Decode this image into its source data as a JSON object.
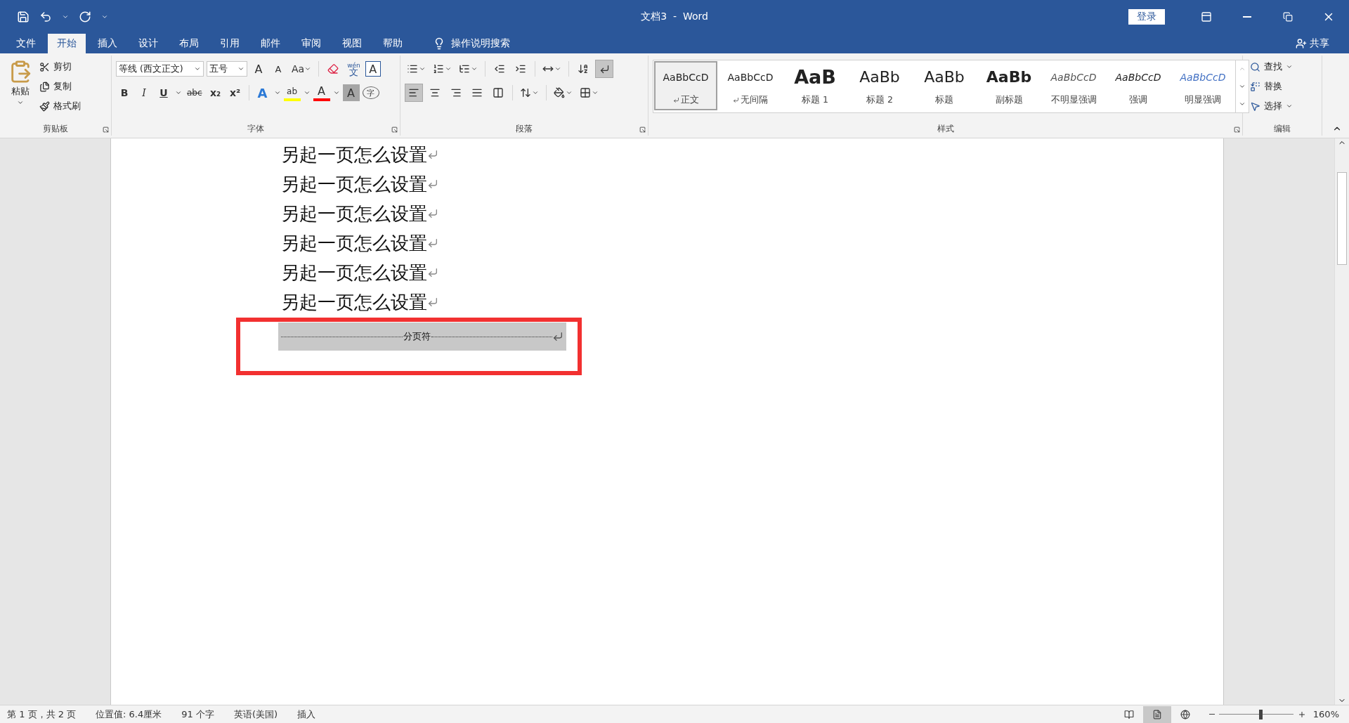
{
  "window": {
    "title": "文档3  -  Word",
    "login": "登录"
  },
  "tabs": [
    {
      "label": "文件",
      "selected": false
    },
    {
      "label": "开始",
      "selected": true
    },
    {
      "label": "插入",
      "selected": false
    },
    {
      "label": "设计",
      "selected": false
    },
    {
      "label": "布局",
      "selected": false
    },
    {
      "label": "引用",
      "selected": false
    },
    {
      "label": "邮件",
      "selected": false
    },
    {
      "label": "审阅",
      "selected": false
    },
    {
      "label": "视图",
      "selected": false
    },
    {
      "label": "帮助",
      "selected": false
    }
  ],
  "tell_me": "操作说明搜索",
  "share": "共享",
  "clipboard": {
    "paste": "粘贴",
    "items": [
      "剪切",
      "复制",
      "格式刷"
    ],
    "label": "剪贴板"
  },
  "font": {
    "name": "等线 (西文正文)",
    "size": "五号",
    "label": "字体",
    "tools": [
      {
        "kind": "grow",
        "label": "A"
      },
      {
        "kind": "shrink",
        "label": "A"
      },
      {
        "kind": "case",
        "label": "Aa"
      }
    ],
    "phonetic": {
      "top": "wén",
      "bottom": "文"
    },
    "border_char": "A",
    "format_buttons": [
      {
        "kind": "bold",
        "label": "B"
      },
      {
        "kind": "italic",
        "label": "I"
      },
      {
        "kind": "underline",
        "label": "U"
      },
      {
        "kind": "strike",
        "label": "abc"
      },
      {
        "kind": "subscript",
        "label": "x₂"
      },
      {
        "kind": "superscript",
        "label": "x²"
      },
      {
        "kind": "text_effect",
        "label": "A"
      },
      {
        "kind": "highlight",
        "label": "ab"
      },
      {
        "kind": "font_color",
        "label": "A"
      },
      {
        "kind": "shading",
        "label": "A"
      },
      {
        "kind": "enclose",
        "label": "字"
      }
    ]
  },
  "paragraph": {
    "label": "段落",
    "show_marks": {
      "selected": true
    },
    "alignments": [
      {
        "kind": "left",
        "selected": true
      },
      {
        "kind": "center",
        "selected": false
      },
      {
        "kind": "right",
        "selected": false
      },
      {
        "kind": "justify",
        "selected": false
      },
      {
        "kind": "distributed",
        "selected": false
      }
    ]
  },
  "styles": {
    "label": "样式",
    "items": [
      {
        "kind": "normal",
        "preview": "AaBbCcD",
        "label": "正文",
        "linked": true,
        "selected": true
      },
      {
        "kind": "no_spacing",
        "preview": "AaBbCcD",
        "label": "无间隔",
        "linked": true,
        "selected": false
      },
      {
        "kind": "heading1",
        "preview": "AaB",
        "label": "标题 1",
        "linked": false,
        "selected": false
      },
      {
        "kind": "heading2",
        "preview": "AaBb",
        "label": "标题 2",
        "linked": false,
        "selected": false
      },
      {
        "kind": "title",
        "preview": "AaBb",
        "label": "标题",
        "linked": false,
        "selected": false
      },
      {
        "kind": "subtitle",
        "preview": "AaBb",
        "label": "副标题",
        "linked": false,
        "selected": false
      },
      {
        "kind": "subtle",
        "preview": "AaBbCcD",
        "label": "不明显强调",
        "linked": false,
        "selected": false
      },
      {
        "kind": "emphasis",
        "preview": "AaBbCcD",
        "label": "强调",
        "linked": false,
        "selected": false
      },
      {
        "kind": "intense",
        "preview": "AaBbCcD",
        "label": "明显强调",
        "linked": false,
        "selected": false
      }
    ]
  },
  "editing": {
    "label": "编辑",
    "items": [
      {
        "kind": "find",
        "label": "查找"
      },
      {
        "kind": "replace",
        "label": "替换"
      },
      {
        "kind": "select",
        "label": "选择"
      }
    ]
  },
  "document": {
    "lines": [
      "另起一页怎么设置",
      "另起一页怎么设置",
      "另起一页怎么设置",
      "另起一页怎么设置",
      "另起一页怎么设置",
      "另起一页怎么设置"
    ],
    "page_break": "分页符"
  },
  "status_bar": {
    "items": [
      "第 1 页，共 2 页",
      "位置值: 6.4厘米",
      "91 个字",
      "英语(美国)",
      "插入"
    ],
    "views": [
      {
        "kind": "read",
        "selected": false
      },
      {
        "kind": "print",
        "selected": true
      },
      {
        "kind": "web",
        "selected": false
      }
    ],
    "zoom": {
      "level": 0.56,
      "label": "160%"
    }
  }
}
